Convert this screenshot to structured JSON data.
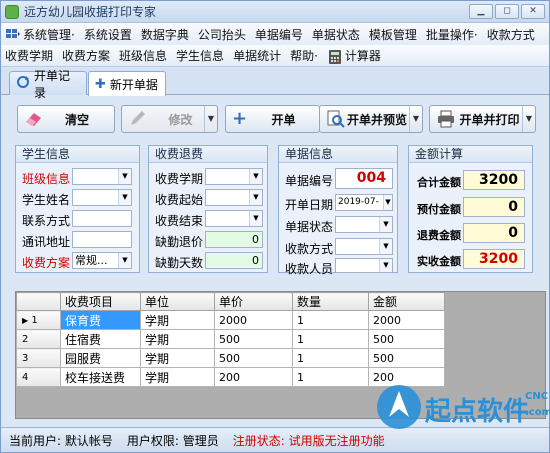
{
  "window": {
    "title": "远方幼儿园收据打印专家",
    "buttons": [
      "▁",
      "◻",
      "✕"
    ]
  },
  "menu": {
    "row1": [
      "系统管理·",
      "系统设置",
      "数据字典",
      "公司抬头",
      "单据编号",
      "单据状态",
      "模板管理",
      "批量操作·",
      "收款方式"
    ],
    "row2": [
      "收费学期",
      "收费方案",
      "班级信息",
      "学生信息",
      "单据统计",
      "帮助·",
      "计算器"
    ]
  },
  "tabs": [
    {
      "label": "开单记录",
      "icon": "refresh-icon"
    },
    {
      "label": "新开单据",
      "icon": "plus-icon"
    }
  ],
  "toolbar": {
    "clear": "清空",
    "edit": "修改",
    "open": "开单",
    "open_preview": "开单并预览",
    "open_print": "开单并打印"
  },
  "student": {
    "title": "学生信息",
    "class_label": "班级信息",
    "name_label": "学生姓名",
    "contact_label": "联系方式",
    "address_label": "通讯地址",
    "plan_label": "收费方案",
    "plan_value": "常规..."
  },
  "fee": {
    "title": "收费退费",
    "term_label": "收费学期",
    "start_label": "收费起始",
    "end_label": "收费结束",
    "absence_price_label": "缺勤退价",
    "absence_price_value": "0",
    "absence_days_label": "缺勤天数",
    "absence_days_value": "0"
  },
  "receipt": {
    "title": "单据信息",
    "no_label": "单据编号",
    "no_value": "004",
    "date_label": "开单日期",
    "date_value": "2019-07-",
    "status_label": "单据状态",
    "pay_label": "收款方式",
    "payee_label": "收款人员"
  },
  "amount": {
    "title": "金额计算",
    "total_label": "合计金额",
    "total_value": "3200",
    "prepaid_label": "预付金额",
    "prepaid_value": "0",
    "refund_label": "退费金额",
    "refund_value": "0",
    "actual_label": "实收金额",
    "actual_value": "3200"
  },
  "grid": {
    "headers": [
      "收费项目",
      "单位",
      "单价",
      "数量",
      "金额"
    ],
    "rows": [
      {
        "n": "1",
        "item": "保育费",
        "unit": "学期",
        "price": "2000",
        "qty": "1",
        "amount": "2000"
      },
      {
        "n": "2",
        "item": "住宿费",
        "unit": "学期",
        "price": "500",
        "qty": "1",
        "amount": "500"
      },
      {
        "n": "3",
        "item": "园服费",
        "unit": "学期",
        "price": "500",
        "qty": "1",
        "amount": "500"
      },
      {
        "n": "4",
        "item": "校车接送费",
        "unit": "学期",
        "price": "200",
        "qty": "1",
        "amount": "200"
      }
    ]
  },
  "status": {
    "user": "当前用户: 默认帐号",
    "perm": "用户权限: 管理员",
    "reg": "注册状态: 试用版无注册功能"
  },
  "watermark": {
    "text": "起点软件",
    "sub": "CNC",
    "sub2": ".com"
  },
  "colors": {
    "accent": "#3399ff",
    "warning": "#d40000",
    "panel": "#eaf1fa"
  }
}
